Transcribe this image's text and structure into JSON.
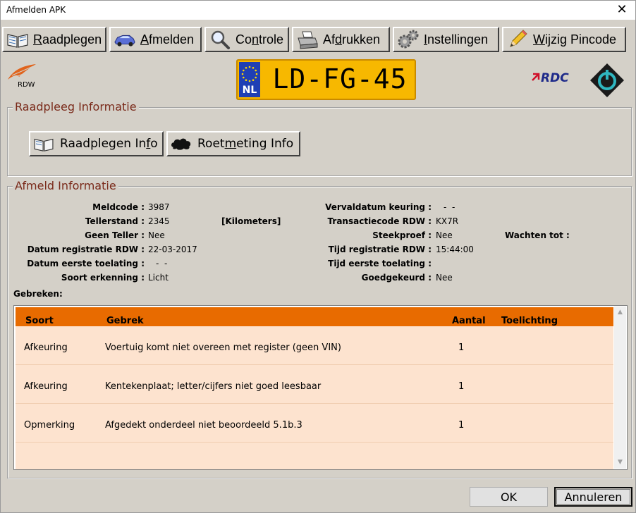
{
  "window": {
    "title": "Afmelden APK",
    "close_glyph": "✕"
  },
  "toolbar": {
    "raadplegen": {
      "pre": "",
      "acc": "R",
      "post": "aadplegen",
      "icon": "book-icon"
    },
    "afmelden": {
      "pre": "",
      "acc": "A",
      "post": "fmelden",
      "icon": "car-icon"
    },
    "controle": {
      "pre": "Co",
      "acc": "n",
      "post": "trole",
      "icon": "magnifier-icon"
    },
    "afdrukken": {
      "pre": "Af",
      "acc": "d",
      "post": "rukken",
      "icon": "printer-icon"
    },
    "instellingen": {
      "pre": "",
      "acc": "I",
      "post": "nstellingen",
      "icon": "gears-icon"
    },
    "pincode": {
      "pre": "",
      "acc": "W",
      "post": "ijzig Pincode",
      "icon": "pencil-icon"
    }
  },
  "logos": {
    "rdw_text": "RDW",
    "rdc_text": "RDC"
  },
  "plate": {
    "country": "NL",
    "number": "LD-FG-45"
  },
  "raadpleeg": {
    "title": "Raadpleeg Informatie",
    "info_btn": {
      "pre": "Raadplegen In",
      "acc": "f",
      "post": "o"
    },
    "roet_btn": {
      "pre": "Roet",
      "acc": "m",
      "post": "eting Info"
    }
  },
  "afmeld": {
    "title": "Afmeld Informatie",
    "left": [
      {
        "label": "Meldcode :",
        "value": "3987"
      },
      {
        "label": "Tellerstand :",
        "value": "2345"
      },
      {
        "label": "Geen Teller :",
        "value": "Nee"
      },
      {
        "label": "Datum registratie RDW :",
        "value": "22-03-2017"
      },
      {
        "label": "Datum eerste toelating :",
        "value": "-  -"
      },
      {
        "label": "Soort erkenning :",
        "value": "Licht"
      }
    ],
    "unit": "[Kilometers]",
    "right": [
      {
        "label": "Vervaldatum keuring :",
        "value": "-  -"
      },
      {
        "label": "Transactiecode RDW :",
        "value": "KX7R"
      },
      {
        "label": "Steekproef :",
        "value": "Nee"
      },
      {
        "label": "Tijd registratie RDW :",
        "value": "15:44:00"
      },
      {
        "label": "Tijd eerste toelating :",
        "value": ""
      },
      {
        "label": "Goedgekeurd :",
        "value": "Nee"
      }
    ],
    "wachten_label": "Wachten tot :",
    "gebreken_label": "Gebreken:"
  },
  "table": {
    "headers": {
      "soort": "Soort",
      "gebrek": "Gebrek",
      "aantal": "Aantal",
      "toelichting": "Toelichting"
    },
    "rows": [
      {
        "soort": "Afkeuring",
        "gebrek": "Voertuig komt niet overeen met register (geen VIN)",
        "aantal": "1",
        "toelichting": ""
      },
      {
        "soort": "Afkeuring",
        "gebrek": "Kentekenplaat; letter/cijfers niet goed leesbaar",
        "aantal": "1",
        "toelichting": ""
      },
      {
        "soort": "Opmerking",
        "gebrek": "Afgedekt onderdeel niet beoordeeld 5.1b.3",
        "aantal": "1",
        "toelichting": ""
      }
    ]
  },
  "dialog": {
    "ok": "OK",
    "cancel": "Annuleren"
  },
  "colors": {
    "header": "#e86b00",
    "row_bg": "#fde3cf",
    "group_title": "#7a2a1a",
    "plate": "#f7b800",
    "eu_blue": "#1f3fb4"
  }
}
